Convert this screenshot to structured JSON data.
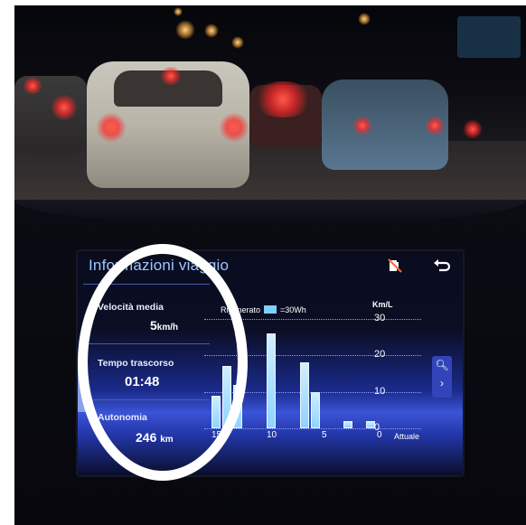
{
  "screen": {
    "title": "Informazioni viaggio",
    "icons": [
      "fuel-off-icon",
      "back-icon"
    ],
    "stats": {
      "avg_speed_label": "Velocità media",
      "avg_speed_value": "5",
      "avg_speed_unit": "km/h",
      "elapsed_label": "Tempo trascorso",
      "elapsed_value": "01:48",
      "range_label": "Autonomia",
      "range_value": "246",
      "range_unit": "km"
    },
    "chart": {
      "legend_text": "Rigenerato",
      "legend_value": "=30Wh",
      "unit": "Km/L",
      "y_ticks": [
        "30",
        "20",
        "10",
        "0"
      ],
      "x_ticks": [
        "15",
        "10",
        "5",
        "0"
      ],
      "current_label": "Attuale"
    },
    "side_buttons": [
      "zoom-icon",
      "chevron-right-icon"
    ]
  },
  "chart_data": {
    "type": "bar",
    "x": [
      15,
      14,
      13,
      12,
      11,
      10,
      9,
      8,
      7,
      6,
      5,
      4,
      3,
      2,
      1,
      0
    ],
    "values": [
      9,
      17,
      12,
      0,
      0,
      26,
      0,
      0,
      18,
      10,
      0,
      0,
      2,
      0,
      2,
      0
    ],
    "ylabel": "Km/L",
    "ylim": [
      0,
      30
    ],
    "xlabel": "",
    "legend": [
      "Rigenerato =30Wh"
    ]
  }
}
